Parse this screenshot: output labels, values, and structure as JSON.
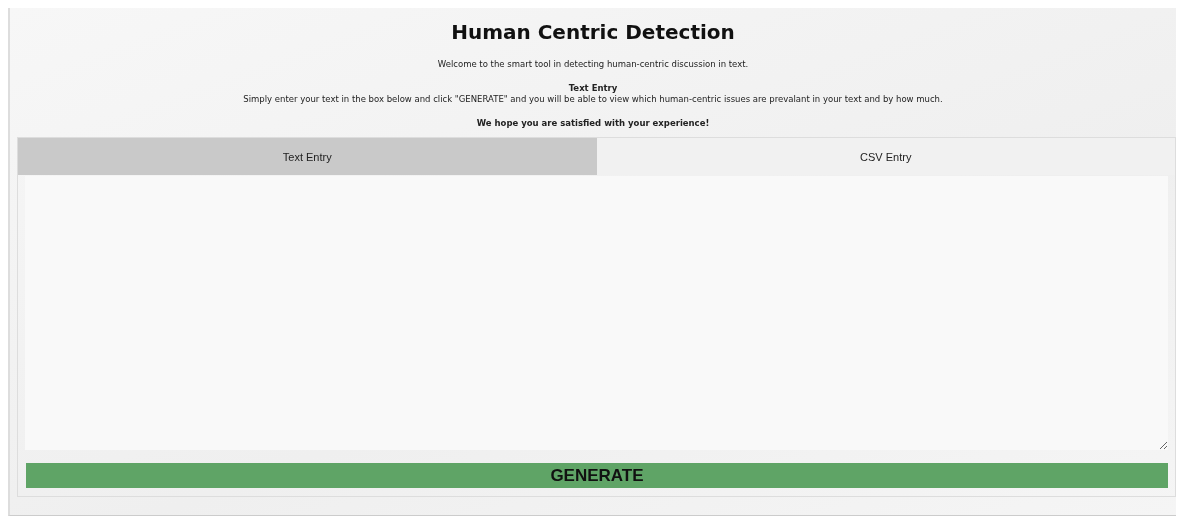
{
  "title": "Human Centric Detection",
  "intro": "Welcome to the smart tool in detecting human-centric discussion in text.",
  "section_heading": "Text Entry",
  "instructions": "Simply enter your text in the box below and click \"GENERATE\" and you will be able to view which human-centric issues are prevalant in your text and by how much.",
  "closing": "We hope you are satisfied with your experience!",
  "tabs": [
    {
      "label": "Text Entry",
      "selected": true
    },
    {
      "label": "CSV Entry",
      "selected": false
    }
  ],
  "generate_button": "GENERATE"
}
